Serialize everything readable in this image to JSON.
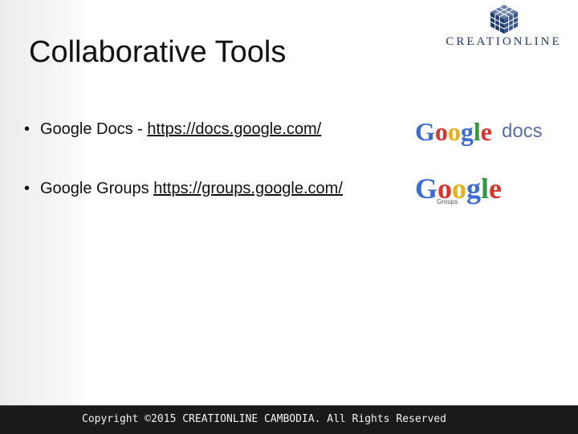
{
  "slide": {
    "title": "Collaborative Tools",
    "bullets": [
      {
        "text": "Google Docs - ",
        "link": "https://docs.google.com/",
        "logo": "Google docs logo"
      },
      {
        "text": "Google Groups ",
        "link": "https://groups.google.com/",
        "logo": "Google Groups logo"
      }
    ],
    "docs_logo": {
      "word": "Google",
      "suffix": "docs"
    },
    "groups_logo": {
      "word": "Google",
      "suffix": "Groups"
    }
  },
  "brand": {
    "name": "CREATIONLINE",
    "color": "#1f3a6e"
  },
  "footer": {
    "text": "Copyright ©2015 CREATIONLINE CAMBODIA. All Rights Reserved"
  },
  "colors": {
    "google_blue": "#3b6bd6",
    "google_red": "#d8342b",
    "google_yellow": "#e8b010",
    "google_green": "#2e9a3c"
  }
}
